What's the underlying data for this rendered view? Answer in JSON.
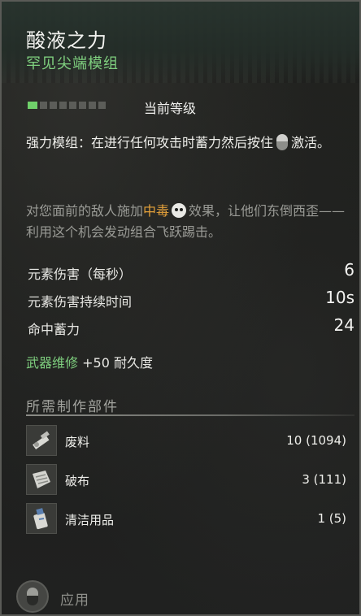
{
  "header": {
    "title": "酸液之力",
    "subtitle": "罕见尖端模组"
  },
  "level": {
    "pips_total": 8,
    "pips_filled": 1,
    "label": "当前等级"
  },
  "description": {
    "part1": "强力模组：在进行任何攻击时蓄力然后按住",
    "part2": "激活。",
    "icon": "mouse-right-button-icon"
  },
  "lore": {
    "part1": "对您面前的敌人施加",
    "highlight": "中毒",
    "highlight_color": "#e6a23a",
    "icon": "skull-icon",
    "part2": "效果，让他们东倒西歪——利用这个机会发动组合飞跃踢击。"
  },
  "stats": [
    {
      "label": "元素伤害（每秒）",
      "value": "6"
    },
    {
      "label": "元素伤害持续时间",
      "value": "10s"
    },
    {
      "label": "命中蓄力",
      "value": "24"
    }
  ],
  "repair": {
    "label": "武器维修",
    "value": "+50 耐久度"
  },
  "materials_section": {
    "title": "所需制作部件",
    "items": [
      {
        "name": "废料",
        "qty": "10 (1094)",
        "icon": "scrap-icon"
      },
      {
        "name": "破布",
        "qty": "3 (111)",
        "icon": "rags-icon"
      },
      {
        "name": "清洁用品",
        "qty": "1 (5)",
        "icon": "cleaning-supplies-icon"
      }
    ]
  },
  "apply": {
    "label": "应用",
    "icon": "mouse-button-icon"
  },
  "colors": {
    "accent_green": "#7fd07f",
    "poison_orange": "#e6a23a"
  }
}
